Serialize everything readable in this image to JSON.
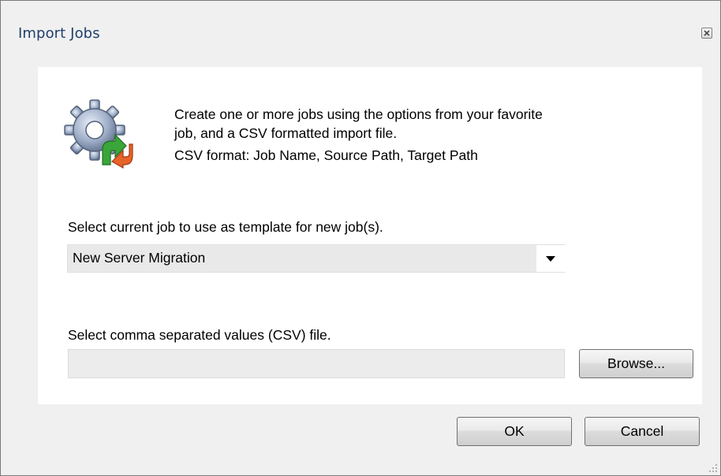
{
  "window": {
    "title": "Import Jobs",
    "close_icon": "close-icon"
  },
  "header": {
    "icon": "gear-import-icon",
    "description_line1": "Create one or more jobs using the options from your favorite",
    "description_line2": "job, and a CSV formatted import file.",
    "csv_format": "CSV format: Job Name, Source Path, Target Path"
  },
  "template_section": {
    "label": "Select current job to use as template for new job(s).",
    "selected_job": "New Server Migration",
    "dropdown_icon": "chevron-down-icon"
  },
  "csv_section": {
    "label": "Select comma separated values (CSV) file.",
    "file_path": "",
    "browse_label": "Browse..."
  },
  "footer": {
    "ok_label": "OK",
    "cancel_label": "Cancel"
  },
  "colors": {
    "title_text": "#1f3f6a",
    "dialog_background": "#f0f0f0",
    "panel_background": "#ffffff",
    "gear": "#8a9bb8",
    "arrow_green": "#3aa63a",
    "arrow_orange": "#e8632a"
  }
}
